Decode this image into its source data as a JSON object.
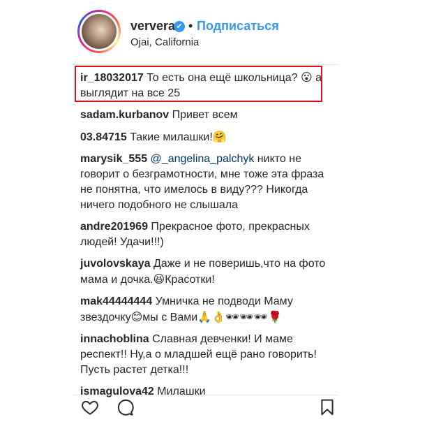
{
  "header": {
    "username": "ververa",
    "separator": "•",
    "follow_label": "Подписаться",
    "location": "Ojai, California",
    "verified_icon": "✔"
  },
  "comments": [
    {
      "author": "ir_18032017",
      "text_before": "То есть она ещё школьница?",
      "emoji": "😮",
      "text_after": " а выглядит на все 25",
      "highlighted": true
    },
    {
      "author": "sadam.kurbanov",
      "text": "Привет всем"
    },
    {
      "author": "03.84715",
      "text": "Такие милашки!",
      "emoji": "🤗"
    },
    {
      "author": "marysik_555",
      "mention": "@_angelina_palchyk",
      "text": " никто не говорит о безграмотности, мне тоже эта фраза не понятна, что имелось в виду??? Никогда ничего подобного не слышала"
    },
    {
      "author": "andre201969",
      "text": "Прекрасное фото, прекрасных людей! Удачи!!!)"
    },
    {
      "author": "juvolovskaya",
      "text_before": "Даже и не поверишь,что на фото мама и дочка.",
      "emoji": "😆",
      "text_after": "Красотки!"
    },
    {
      "author": "mak44444444",
      "text_before": "Умничка не подводи Маму звездочку",
      "emoji": "😊",
      "text_after": "мы с Вами",
      "emoji_after": "🙏👌🕶🕶🕶🌹"
    },
    {
      "author": "innachoblina",
      "text": "Славная девченки! И маме респект!! Ну,а о младшей ещё рано говорить! Пусть растет детка!!!"
    },
    {
      "author": "ismagulova42",
      "text": "Милашки"
    }
  ],
  "actions": {
    "like_icon": "heart-icon",
    "comment_icon": "comment-icon",
    "save_icon": "bookmark-icon"
  },
  "colors": {
    "link": "#3897f0",
    "highlight": "#e0101a",
    "text": "#262626"
  }
}
